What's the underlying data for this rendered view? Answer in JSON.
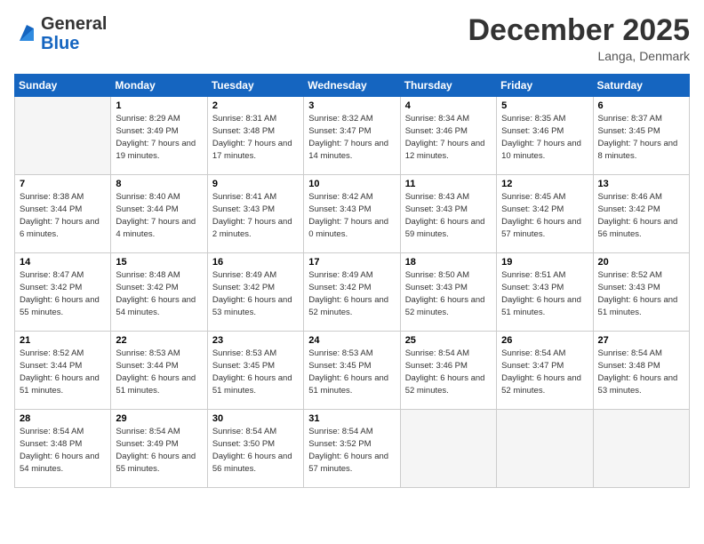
{
  "header": {
    "logo_general": "General",
    "logo_blue": "Blue",
    "month_title": "December 2025",
    "location": "Langa, Denmark"
  },
  "weekdays": [
    "Sunday",
    "Monday",
    "Tuesday",
    "Wednesday",
    "Thursday",
    "Friday",
    "Saturday"
  ],
  "weeks": [
    [
      {
        "day": "",
        "sunrise": "",
        "sunset": "",
        "daylight": ""
      },
      {
        "day": "1",
        "sunrise": "Sunrise: 8:29 AM",
        "sunset": "Sunset: 3:49 PM",
        "daylight": "Daylight: 7 hours and 19 minutes."
      },
      {
        "day": "2",
        "sunrise": "Sunrise: 8:31 AM",
        "sunset": "Sunset: 3:48 PM",
        "daylight": "Daylight: 7 hours and 17 minutes."
      },
      {
        "day": "3",
        "sunrise": "Sunrise: 8:32 AM",
        "sunset": "Sunset: 3:47 PM",
        "daylight": "Daylight: 7 hours and 14 minutes."
      },
      {
        "day": "4",
        "sunrise": "Sunrise: 8:34 AM",
        "sunset": "Sunset: 3:46 PM",
        "daylight": "Daylight: 7 hours and 12 minutes."
      },
      {
        "day": "5",
        "sunrise": "Sunrise: 8:35 AM",
        "sunset": "Sunset: 3:46 PM",
        "daylight": "Daylight: 7 hours and 10 minutes."
      },
      {
        "day": "6",
        "sunrise": "Sunrise: 8:37 AM",
        "sunset": "Sunset: 3:45 PM",
        "daylight": "Daylight: 7 hours and 8 minutes."
      }
    ],
    [
      {
        "day": "7",
        "sunrise": "Sunrise: 8:38 AM",
        "sunset": "Sunset: 3:44 PM",
        "daylight": "Daylight: 7 hours and 6 minutes."
      },
      {
        "day": "8",
        "sunrise": "Sunrise: 8:40 AM",
        "sunset": "Sunset: 3:44 PM",
        "daylight": "Daylight: 7 hours and 4 minutes."
      },
      {
        "day": "9",
        "sunrise": "Sunrise: 8:41 AM",
        "sunset": "Sunset: 3:43 PM",
        "daylight": "Daylight: 7 hours and 2 minutes."
      },
      {
        "day": "10",
        "sunrise": "Sunrise: 8:42 AM",
        "sunset": "Sunset: 3:43 PM",
        "daylight": "Daylight: 7 hours and 0 minutes."
      },
      {
        "day": "11",
        "sunrise": "Sunrise: 8:43 AM",
        "sunset": "Sunset: 3:43 PM",
        "daylight": "Daylight: 6 hours and 59 minutes."
      },
      {
        "day": "12",
        "sunrise": "Sunrise: 8:45 AM",
        "sunset": "Sunset: 3:42 PM",
        "daylight": "Daylight: 6 hours and 57 minutes."
      },
      {
        "day": "13",
        "sunrise": "Sunrise: 8:46 AM",
        "sunset": "Sunset: 3:42 PM",
        "daylight": "Daylight: 6 hours and 56 minutes."
      }
    ],
    [
      {
        "day": "14",
        "sunrise": "Sunrise: 8:47 AM",
        "sunset": "Sunset: 3:42 PM",
        "daylight": "Daylight: 6 hours and 55 minutes."
      },
      {
        "day": "15",
        "sunrise": "Sunrise: 8:48 AM",
        "sunset": "Sunset: 3:42 PM",
        "daylight": "Daylight: 6 hours and 54 minutes."
      },
      {
        "day": "16",
        "sunrise": "Sunrise: 8:49 AM",
        "sunset": "Sunset: 3:42 PM",
        "daylight": "Daylight: 6 hours and 53 minutes."
      },
      {
        "day": "17",
        "sunrise": "Sunrise: 8:49 AM",
        "sunset": "Sunset: 3:42 PM",
        "daylight": "Daylight: 6 hours and 52 minutes."
      },
      {
        "day": "18",
        "sunrise": "Sunrise: 8:50 AM",
        "sunset": "Sunset: 3:43 PM",
        "daylight": "Daylight: 6 hours and 52 minutes."
      },
      {
        "day": "19",
        "sunrise": "Sunrise: 8:51 AM",
        "sunset": "Sunset: 3:43 PM",
        "daylight": "Daylight: 6 hours and 51 minutes."
      },
      {
        "day": "20",
        "sunrise": "Sunrise: 8:52 AM",
        "sunset": "Sunset: 3:43 PM",
        "daylight": "Daylight: 6 hours and 51 minutes."
      }
    ],
    [
      {
        "day": "21",
        "sunrise": "Sunrise: 8:52 AM",
        "sunset": "Sunset: 3:44 PM",
        "daylight": "Daylight: 6 hours and 51 minutes."
      },
      {
        "day": "22",
        "sunrise": "Sunrise: 8:53 AM",
        "sunset": "Sunset: 3:44 PM",
        "daylight": "Daylight: 6 hours and 51 minutes."
      },
      {
        "day": "23",
        "sunrise": "Sunrise: 8:53 AM",
        "sunset": "Sunset: 3:45 PM",
        "daylight": "Daylight: 6 hours and 51 minutes."
      },
      {
        "day": "24",
        "sunrise": "Sunrise: 8:53 AM",
        "sunset": "Sunset: 3:45 PM",
        "daylight": "Daylight: 6 hours and 51 minutes."
      },
      {
        "day": "25",
        "sunrise": "Sunrise: 8:54 AM",
        "sunset": "Sunset: 3:46 PM",
        "daylight": "Daylight: 6 hours and 52 minutes."
      },
      {
        "day": "26",
        "sunrise": "Sunrise: 8:54 AM",
        "sunset": "Sunset: 3:47 PM",
        "daylight": "Daylight: 6 hours and 52 minutes."
      },
      {
        "day": "27",
        "sunrise": "Sunrise: 8:54 AM",
        "sunset": "Sunset: 3:48 PM",
        "daylight": "Daylight: 6 hours and 53 minutes."
      }
    ],
    [
      {
        "day": "28",
        "sunrise": "Sunrise: 8:54 AM",
        "sunset": "Sunset: 3:48 PM",
        "daylight": "Daylight: 6 hours and 54 minutes."
      },
      {
        "day": "29",
        "sunrise": "Sunrise: 8:54 AM",
        "sunset": "Sunset: 3:49 PM",
        "daylight": "Daylight: 6 hours and 55 minutes."
      },
      {
        "day": "30",
        "sunrise": "Sunrise: 8:54 AM",
        "sunset": "Sunset: 3:50 PM",
        "daylight": "Daylight: 6 hours and 56 minutes."
      },
      {
        "day": "31",
        "sunrise": "Sunrise: 8:54 AM",
        "sunset": "Sunset: 3:52 PM",
        "daylight": "Daylight: 6 hours and 57 minutes."
      },
      {
        "day": "",
        "sunrise": "",
        "sunset": "",
        "daylight": ""
      },
      {
        "day": "",
        "sunrise": "",
        "sunset": "",
        "daylight": ""
      },
      {
        "day": "",
        "sunrise": "",
        "sunset": "",
        "daylight": ""
      }
    ]
  ]
}
